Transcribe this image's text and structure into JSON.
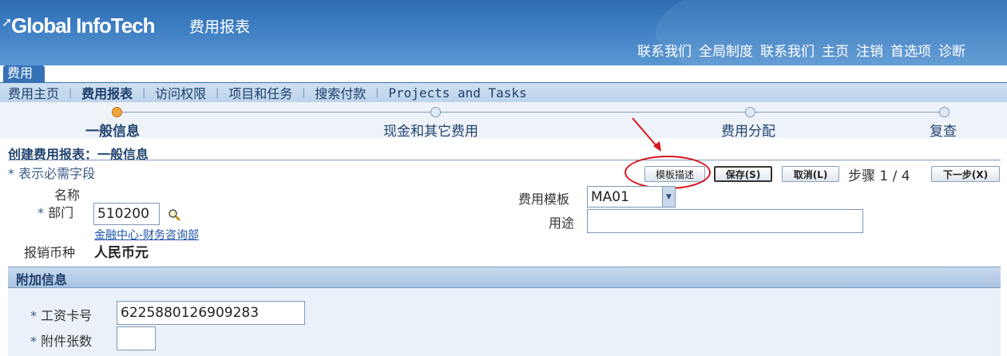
{
  "header": {
    "logo": "Global InfoTech",
    "app_title": "费用报表",
    "global_links": [
      "联系我们",
      "全局制度",
      "联系我们",
      "主页",
      "注销",
      "首选项",
      "诊断"
    ]
  },
  "tab": {
    "label": "费用"
  },
  "subnav": {
    "items": [
      "费用主页",
      "费用报表",
      "访问权限",
      "项目和任务",
      "搜索付款",
      "Projects and Tasks"
    ],
    "active_index": 1
  },
  "train": {
    "steps": [
      "一般信息",
      "现金和其它费用",
      "费用分配",
      "复查"
    ],
    "current_index": 0
  },
  "page": {
    "title": "创建费用报表：一般信息",
    "required_hint": "* 表示必需字段"
  },
  "buttons": {
    "template_desc": "模板描述",
    "save": "保存(S)",
    "cancel": "取消(L)",
    "step_text": "步骤 1 / 4",
    "next": "下一步(X)"
  },
  "form": {
    "name_label": "名称",
    "name_value": "",
    "dept_label": "部门",
    "dept_value": "510200",
    "dept_desc": "金融中心-财务咨询部",
    "currency_label": "报销币种",
    "currency_value": "人民币元",
    "template_label": "费用模板",
    "template_value": "MA01",
    "purpose_label": "用途",
    "purpose_value": ""
  },
  "section": {
    "title": "附加信息",
    "card_label": "工资卡号",
    "card_value": "6225880126909283",
    "attach_label": "附件张数",
    "attach_value": ""
  },
  "icons": {
    "search": "magnifier-icon",
    "dropdown": "chevron-down-icon"
  },
  "colors": {
    "header_blue": "#3f80c4",
    "train_current": "#f1a340",
    "annotation_red": "#d8151c"
  }
}
